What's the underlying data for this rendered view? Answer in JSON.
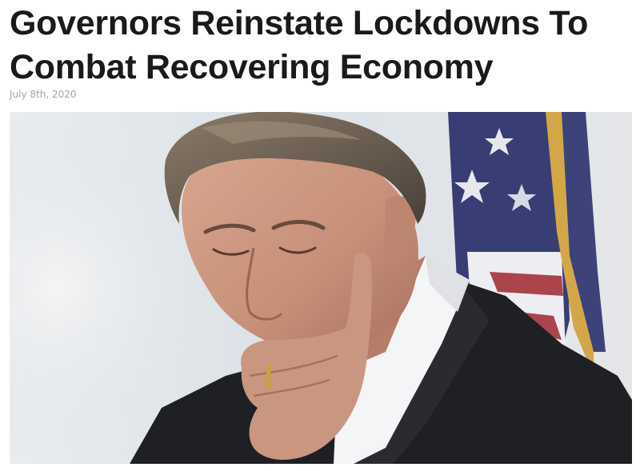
{
  "article": {
    "headline_lines": [
      "Governors Reinstate Lockdowns To",
      "Combat Recovering Economy"
    ],
    "date": "July 8th, 2020"
  },
  "photo": {
    "subject": "man-with-hand-on-face-icon",
    "background_color": "#dfe4e8",
    "flag_icon": "us-flag-icon",
    "colors": {
      "suit": "#1f2024",
      "shirt": "#f4f5f6",
      "skin": "#c99680",
      "hair": "#6b5f52",
      "flag_blue": "#2a2f6b",
      "flag_red": "#a7373f",
      "fringe": "#d2a23a"
    }
  }
}
